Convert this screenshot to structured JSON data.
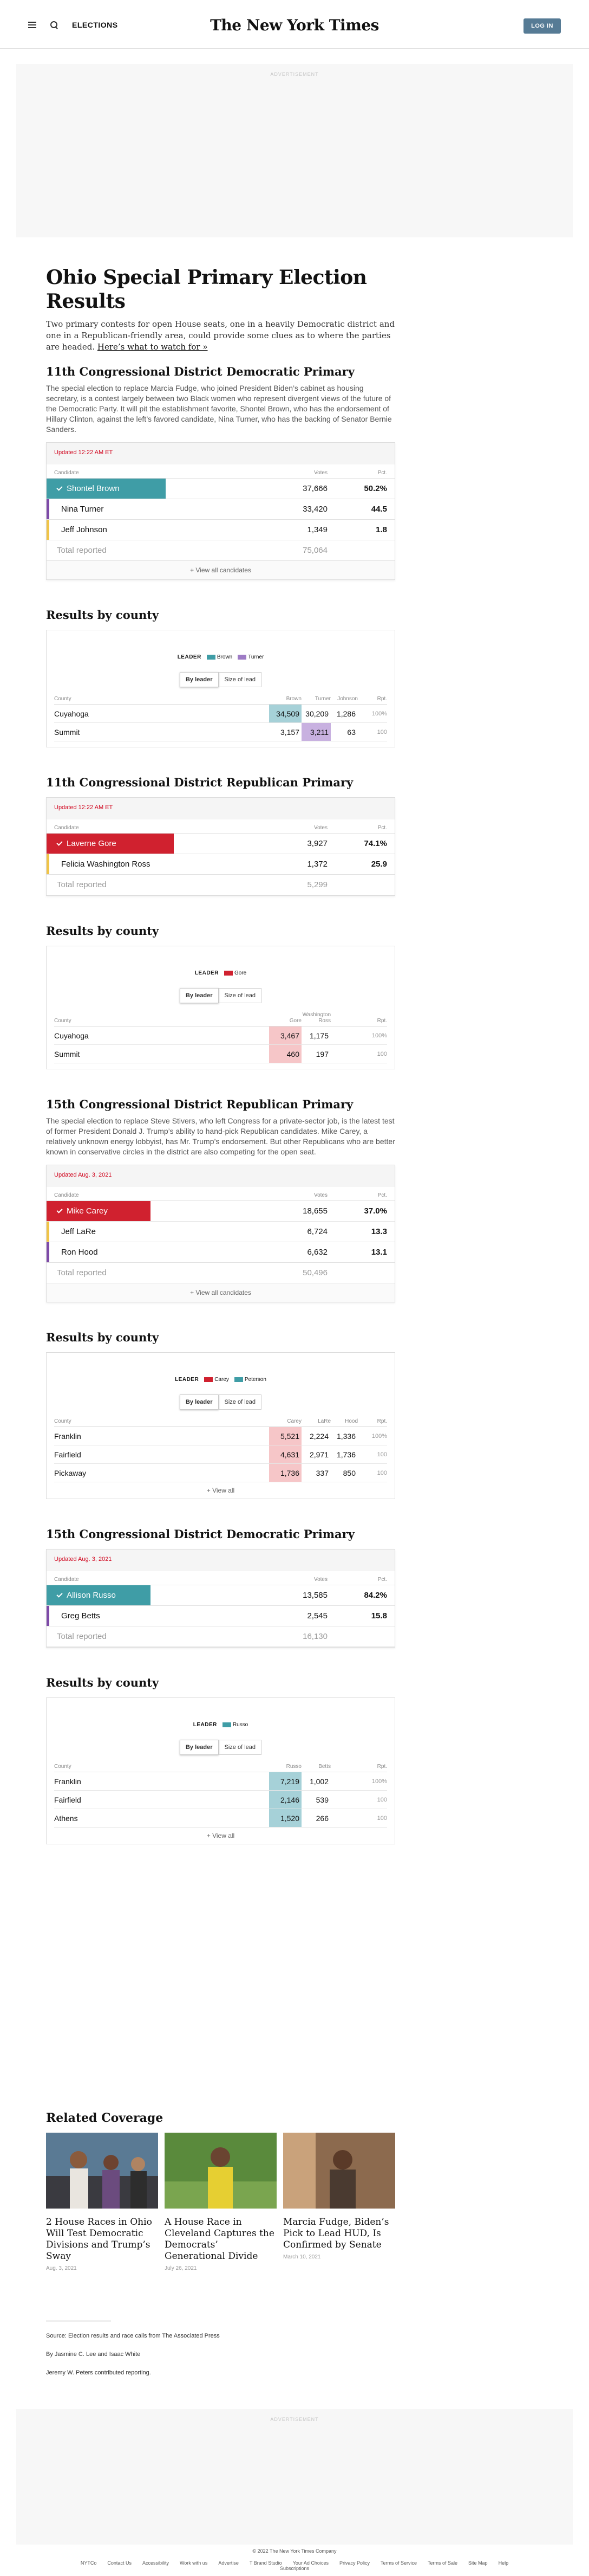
{
  "header": {
    "section": "ELECTIONS",
    "logo": "The New York Times",
    "login": "LOG IN"
  },
  "ad": {
    "label": "ADVERTISEMENT"
  },
  "page": {
    "title": "Ohio Special Primary Election Results",
    "desc": "Two primary contests for open House seats, one in a heavily Democratic district and one in a Republican-friendly area, could provide some clues as to where the parties are headed.",
    "desc_link": "Here’s what to watch for »"
  },
  "races": [
    {
      "title": "11th Congressional District Democratic Primary",
      "desc": "The special election to replace Marcia Fudge, who joined President Biden’s cabinet as housing secretary, is a contest largely between two Black women who represent divergent views of the future of the Democratic Party. It will pit the establishment favorite, Shontel Brown, who has the endorsement of Hillary Clinton, against the left’s favored candidate, Nina Turner, who has the backing of Senator Bernie Sanders.",
      "updated": "Updated 12:22 AM ET",
      "h_candidate": "Candidate",
      "h_votes": "Votes",
      "h_pct": "Pct.",
      "candidates": [
        {
          "name": "Shontel Brown",
          "votes": "37,666",
          "pct": "50.2%",
          "color": "#3f9da6",
          "win": true,
          "fill": 0.55
        },
        {
          "name": "Nina Turner",
          "votes": "33,420",
          "pct": "44.5",
          "color": "#7d4aa8",
          "win": false
        },
        {
          "name": "Jeff Johnson",
          "votes": "1,349",
          "pct": "1.8",
          "color": "#f0c447",
          "win": false
        }
      ],
      "total_label": "Total reported",
      "total": "75,064",
      "view_all": "+ View all candidates"
    },
    {
      "title": "11th Congressional District Republican Primary",
      "desc": "",
      "updated": "Updated 12:22 AM ET",
      "h_candidate": "Candidate",
      "h_votes": "Votes",
      "h_pct": "Pct.",
      "candidates": [
        {
          "name": "Laverne Gore",
          "votes": "3,927",
          "pct": "74.1%",
          "color": "#d0212f",
          "win": true,
          "fill": 0.59
        },
        {
          "name": "Felicia Washington Ross",
          "votes": "1,372",
          "pct": "25.9",
          "color": "#f0c447",
          "win": false
        }
      ],
      "total_label": "Total reported",
      "total": "5,299",
      "view_all": ""
    },
    {
      "title": "15th Congressional District Republican Primary",
      "desc": "The special election to replace Steve Stivers, who left Congress for a private-sector job, is the latest test of former President Donald J. Trump’s ability to hand-pick Republican candidates. Mike Carey, a relatively unknown energy lobbyist, has Mr. Trump’s endorsement. But other Republicans who are better known in conservative circles in the district are also competing for the open seat.",
      "updated": "Updated Aug. 3, 2021",
      "h_candidate": "Candidate",
      "h_votes": "Votes",
      "h_pct": "Pct.",
      "candidates": [
        {
          "name": "Mike Carey",
          "votes": "18,655",
          "pct": "37.0%",
          "color": "#d0212f",
          "win": true,
          "fill": 0.48
        },
        {
          "name": "Jeff LaRe",
          "votes": "6,724",
          "pct": "13.3",
          "color": "#f0c447",
          "win": false
        },
        {
          "name": "Ron Hood",
          "votes": "6,632",
          "pct": "13.1",
          "color": "#7d4aa8",
          "win": false
        }
      ],
      "total_label": "Total reported",
      "total": "50,496",
      "view_all": "+ View all candidates"
    },
    {
      "title": "15th Congressional District Democratic Primary",
      "desc": "",
      "updated": "Updated Aug. 3, 2021",
      "h_candidate": "Candidate",
      "h_votes": "Votes",
      "h_pct": "Pct.",
      "candidates": [
        {
          "name": "Allison Russo",
          "votes": "13,585",
          "pct": "84.2%",
          "color": "#3f9da6",
          "win": true,
          "fill": 0.48
        },
        {
          "name": "Greg Betts",
          "votes": "2,545",
          "pct": "15.8",
          "color": "#7d4aa8",
          "win": false
        }
      ],
      "total_label": "Total reported",
      "total": "16,130",
      "view_all": ""
    }
  ],
  "counties": [
    {
      "title": "Results by county",
      "leader_label": "LEADER",
      "legend": [
        {
          "name": "Brown",
          "color": "#3f9da6"
        },
        {
          "name": "Turner",
          "color": "#9e7bc5"
        }
      ],
      "toggle_a": "By leader",
      "toggle_b": "Size of lead",
      "h_county": "County",
      "h_cands": [
        "Brown",
        "Turner",
        "Johnson"
      ],
      "h_rpt": "Rpt.",
      "rows": [
        {
          "county": "Cuyahoga",
          "v": [
            "34,509",
            "30,209",
            "1,286"
          ],
          "rpt": "100%",
          "lead": 0,
          "color": "#a6d1d8"
        },
        {
          "county": "Summit",
          "v": [
            "3,157",
            "3,211",
            "63"
          ],
          "rpt": "100",
          "lead": 1,
          "color": "#c8b1e0"
        }
      ],
      "view_all": ""
    },
    {
      "title": "Results by county",
      "leader_label": "LEADER",
      "legend": [
        {
          "name": "Gore",
          "color": "#d0212f"
        }
      ],
      "toggle_a": "By leader",
      "toggle_b": "Size of lead",
      "h_county": "County",
      "h_cands": [
        "Gore",
        "Washington Ross",
        ""
      ],
      "h_rpt": "Rpt.",
      "rows": [
        {
          "county": "Cuyahoga",
          "v": [
            "3,467",
            "1,175",
            ""
          ],
          "rpt": "100%",
          "lead": 0,
          "color": "#f6c6c8"
        },
        {
          "county": "Summit",
          "v": [
            "460",
            "197",
            ""
          ],
          "rpt": "100",
          "lead": 0,
          "color": "#f6c6c8"
        }
      ],
      "view_all": ""
    },
    {
      "title": "Results by county",
      "leader_label": "LEADER",
      "legend": [
        {
          "name": "Carey",
          "color": "#d0212f"
        },
        {
          "name": "Peterson",
          "color": "#3f9da6"
        }
      ],
      "toggle_a": "By leader",
      "toggle_b": "Size of lead",
      "h_county": "County",
      "h_cands": [
        "Carey",
        "LaRe",
        "Hood"
      ],
      "h_rpt": "Rpt.",
      "rows": [
        {
          "county": "Franklin",
          "v": [
            "5,521",
            "2,224",
            "1,336"
          ],
          "rpt": "100%",
          "lead": 0,
          "color": "#f6c6c8"
        },
        {
          "county": "Fairfield",
          "v": [
            "4,631",
            "2,971",
            "1,736"
          ],
          "rpt": "100",
          "lead": 0,
          "color": "#f6c6c8"
        },
        {
          "county": "Pickaway",
          "v": [
            "1,736",
            "337",
            "850"
          ],
          "rpt": "100",
          "lead": 0,
          "color": "#f6c6c8"
        }
      ],
      "view_all": "+ View all"
    },
    {
      "title": "Results by county",
      "leader_label": "LEADER",
      "legend": [
        {
          "name": "Russo",
          "color": "#3f9da6"
        }
      ],
      "toggle_a": "By leader",
      "toggle_b": "Size of lead",
      "h_county": "County",
      "h_cands": [
        "Russo",
        "Betts",
        ""
      ],
      "h_rpt": "Rpt.",
      "rows": [
        {
          "county": "Franklin",
          "v": [
            "7,219",
            "1,002",
            ""
          ],
          "rpt": "100%",
          "lead": 0,
          "color": "#a6d1d8"
        },
        {
          "county": "Fairfield",
          "v": [
            "2,146",
            "539",
            ""
          ],
          "rpt": "100",
          "lead": 0,
          "color": "#a6d1d8"
        },
        {
          "county": "Athens",
          "v": [
            "1,520",
            "266",
            ""
          ],
          "rpt": "100",
          "lead": 0,
          "color": "#a6d1d8"
        }
      ],
      "view_all": "+ View all"
    }
  ],
  "related": {
    "heading": "Related Coverage",
    "items": [
      {
        "title": "2 House Races in Ohio Will Test Democratic Divisions and Trump’s Sway",
        "date": "Aug. 3, 2021"
      },
      {
        "title": "A House Race in Cleveland Captures the Democrats’ Generational Divide",
        "date": "July 26, 2021"
      },
      {
        "title": "Marcia Fudge, Biden’s Pick to Lead HUD, Is Confirmed by Senate",
        "date": "March 10, 2021"
      }
    ]
  },
  "notes": {
    "source": "Source: Election results and race calls from The Associated Press",
    "byline": "By Jasmine C. Lee and Isaac White",
    "contrib": "Jeremy W. Peters contributed reporting."
  },
  "footer": {
    "copyright": "© 2022 The New York Times Company",
    "links": [
      "NYTCo",
      "Contact Us",
      "Accessibility",
      "Work with us",
      "Advertise",
      "T Brand Studio",
      "Your Ad Choices",
      "Privacy Policy",
      "Terms of Service",
      "Terms of Sale",
      "Site Map",
      "Help",
      "Subscriptions"
    ]
  }
}
